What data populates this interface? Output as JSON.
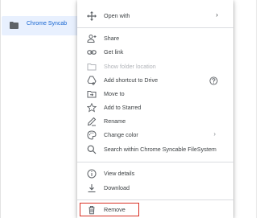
{
  "file": {
    "name": "Chrome Syncab"
  },
  "menu": {
    "open_with": "Open with",
    "share": "Share",
    "get_link": "Get link",
    "show_folder_location": "Show folder location",
    "add_shortcut": "Add shortcut to Drive",
    "move_to": "Move to",
    "add_starred": "Add to Starred",
    "rename": "Rename",
    "change_color": "Change color",
    "search_within": "Search within Chrome Syncable FileSystem",
    "view_details": "View details",
    "download": "Download",
    "remove": "Remove"
  },
  "icons": {
    "open_with": "move-arrows-icon",
    "share": "person-add-icon",
    "get_link": "link-icon",
    "show_folder_location": "folder-outline-icon",
    "add_shortcut": "drive-shortcut-icon",
    "move_to": "folder-move-icon",
    "add_starred": "star-outline-icon",
    "rename": "pencil-icon",
    "change_color": "palette-icon",
    "search_within": "search-icon",
    "view_details": "info-icon",
    "download": "download-icon",
    "remove": "trash-icon",
    "help": "help-circle-icon"
  },
  "colors": {
    "selected_row": "#e8f0fe",
    "file_text": "#1967d2",
    "highlight_box": "#d93025",
    "icon": "#5f6368"
  }
}
